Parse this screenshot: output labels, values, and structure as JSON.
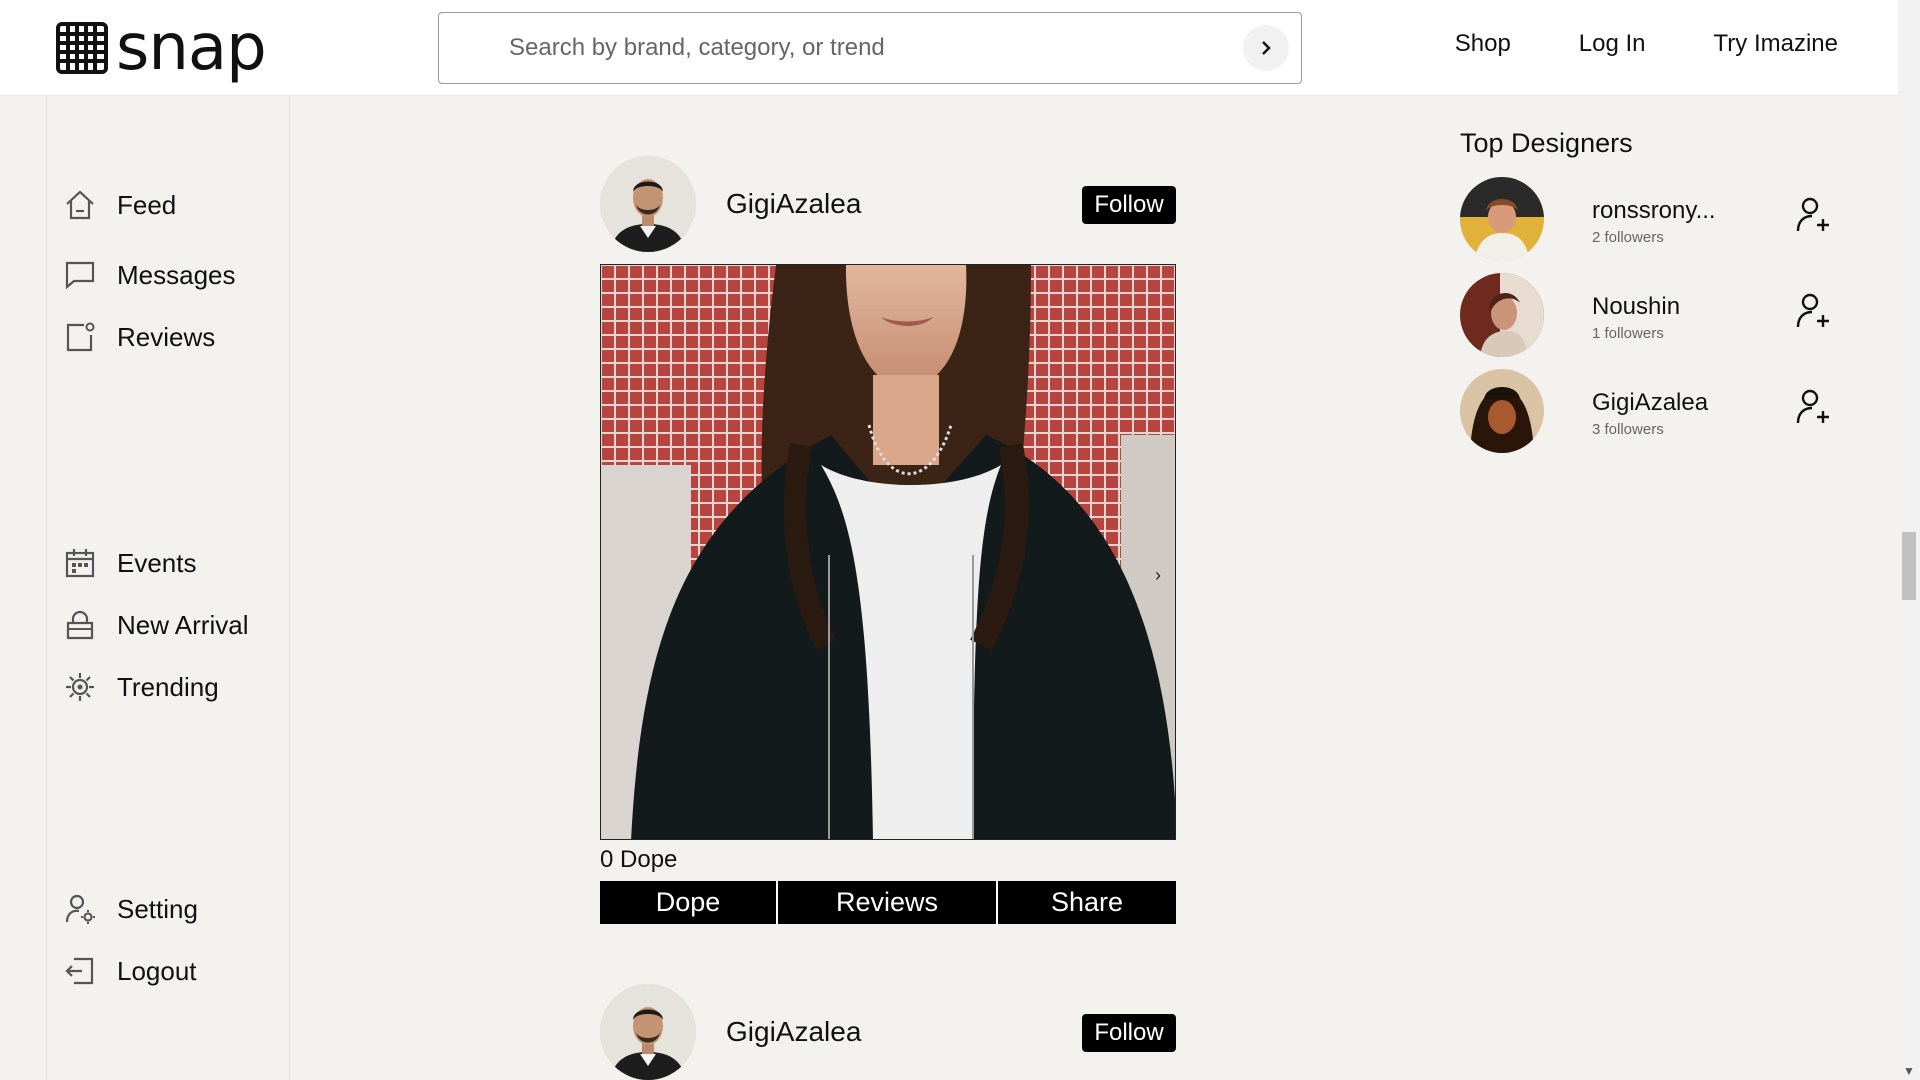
{
  "app": {
    "logo_text": "snap"
  },
  "search": {
    "placeholder": "Search by brand, category, or trend"
  },
  "nav": {
    "shop": "Shop",
    "login": "Log In",
    "try": "Try Imazine"
  },
  "sidebar": {
    "items": [
      {
        "label": "Feed",
        "icon": "home-icon"
      },
      {
        "label": "Messages",
        "icon": "message-icon"
      },
      {
        "label": "Reviews",
        "icon": "review-icon"
      },
      {
        "label": "Events",
        "icon": "calendar-icon"
      },
      {
        "label": "New Arrival",
        "icon": "bag-icon"
      },
      {
        "label": "Trending",
        "icon": "trending-icon"
      },
      {
        "label": "Setting",
        "icon": "user-gear-icon"
      },
      {
        "label": "Logout",
        "icon": "logout-icon"
      }
    ]
  },
  "posts": [
    {
      "user": "GigiAzalea",
      "follow_label": "Follow",
      "dope_count": "0 Dope"
    },
    {
      "user": "GigiAzalea",
      "follow_label": "Follow"
    }
  ],
  "actions": {
    "dope": "Dope",
    "reviews": "Reviews",
    "share": "Share"
  },
  "designers": {
    "title": "Top Designers",
    "list": [
      {
        "name": "ronssrony...",
        "followers": "2 followers"
      },
      {
        "name": "Noushin",
        "followers": "1 followers"
      },
      {
        "name": "GigiAzalea",
        "followers": "3 followers"
      }
    ]
  },
  "colors": {
    "background": "#f3f2ef",
    "header": "#ffffff",
    "button": "#000000"
  }
}
